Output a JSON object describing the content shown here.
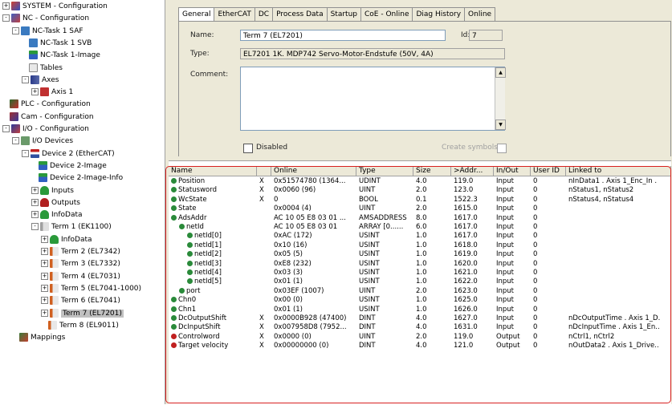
{
  "tree": [
    {
      "label": "SYSTEM - Configuration",
      "icon": "sys",
      "exp": "+"
    },
    {
      "label": "NC - Configuration",
      "icon": "nc",
      "exp": "-"
    },
    {
      "label": "NC-Task 1 SAF",
      "icon": "task",
      "exp": "-"
    },
    {
      "label": "NC-Task 1 SVB",
      "icon": "task",
      "exp": ""
    },
    {
      "label": "NC-Task 1-Image",
      "icon": "img",
      "exp": ""
    },
    {
      "label": "Tables",
      "icon": "tbl",
      "exp": ""
    },
    {
      "label": "Axes",
      "icon": "axes",
      "exp": "-"
    },
    {
      "label": "Axis 1",
      "icon": "axis",
      "exp": "+"
    },
    {
      "label": "PLC - Configuration",
      "icon": "plc",
      "exp": ""
    },
    {
      "label": "Cam - Configuration",
      "icon": "cam",
      "exp": ""
    },
    {
      "label": "I/O - Configuration",
      "icon": "io",
      "exp": "-"
    },
    {
      "label": "I/O Devices",
      "icon": "dev",
      "exp": "-"
    },
    {
      "label": "Device 2 (EtherCAT)",
      "icon": "eth",
      "exp": "-"
    },
    {
      "label": "Device 2-Image",
      "icon": "img",
      "exp": ""
    },
    {
      "label": "Device 2-Image-Info",
      "icon": "img",
      "exp": ""
    },
    {
      "label": "Inputs",
      "icon": "grn",
      "exp": "+"
    },
    {
      "label": "Outputs",
      "icon": "red",
      "exp": "+"
    },
    {
      "label": "InfoData",
      "icon": "grn",
      "exp": "+"
    },
    {
      "label": "Term 1 (EK1100)",
      "icon": "term",
      "exp": "-"
    },
    {
      "label": "InfoData",
      "icon": "grn",
      "exp": "+"
    },
    {
      "label": "Term 2 (EL7342)",
      "icon": "termo",
      "exp": "+"
    },
    {
      "label": "Term 3 (EL7332)",
      "icon": "termo",
      "exp": "+"
    },
    {
      "label": "Term 4 (EL7031)",
      "icon": "termo",
      "exp": "+"
    },
    {
      "label": "Term 5 (EL7041-1000)",
      "icon": "termo",
      "exp": "+"
    },
    {
      "label": "Term 6 (EL7041)",
      "icon": "termo",
      "exp": "+"
    },
    {
      "label": "Term 7 (EL7201)",
      "icon": "termo",
      "exp": "+",
      "selected": true
    },
    {
      "label": "Term 8 (EL9011)",
      "icon": "termo",
      "exp": ""
    },
    {
      "label": "Mappings",
      "icon": "map",
      "exp": ""
    }
  ],
  "tabs": [
    "General",
    "EtherCAT",
    "DC",
    "Process Data",
    "Startup",
    "CoE - Online",
    "Diag History",
    "Online"
  ],
  "general": {
    "name_label": "Name:",
    "name_value": "Term 7 (EL7201)",
    "id_label": "Id:",
    "id_value": "7",
    "type_label": "Type:",
    "type_value": "EL7201 1K. MDP742 Servo-Motor-Endstufe (50V, 4A)",
    "comment_label": "Comment:",
    "comment_value": "",
    "disabled_label": "Disabled",
    "create_symbols_label": "Create symbols"
  },
  "grid": {
    "headers": [
      "Name",
      "",
      "Online",
      "Type",
      "Size",
      ">Addr...",
      "In/Out",
      "User ID",
      "Linked to"
    ],
    "rows": [
      {
        "dir": "in",
        "indent": 0,
        "name": "Position",
        "x": "X",
        "online": "0x51574780 (1364...",
        "type": "UDINT",
        "size": "4.0",
        "addr": "119.0",
        "io": "Input",
        "uid": "0",
        "link": "nInData1 . Axis 1_Enc_In ."
      },
      {
        "dir": "in",
        "indent": 0,
        "name": "Statusword",
        "x": "X",
        "online": "0x0060 (96)",
        "type": "UINT",
        "size": "2.0",
        "addr": "123.0",
        "io": "Input",
        "uid": "0",
        "link": "nStatus1, nStatus2"
      },
      {
        "dir": "in",
        "indent": 0,
        "name": "WcState",
        "x": "X",
        "online": "0",
        "type": "BOOL",
        "size": "0.1",
        "addr": "1522.3",
        "io": "Input",
        "uid": "0",
        "link": "nStatus4, nStatus4"
      },
      {
        "dir": "in",
        "indent": 0,
        "name": "State",
        "x": "",
        "online": "0x0004 (4)",
        "type": "UINT",
        "size": "2.0",
        "addr": "1615.0",
        "io": "Input",
        "uid": "0",
        "link": ""
      },
      {
        "dir": "in",
        "indent": 0,
        "name": "AdsAddr",
        "x": "",
        "online": "AC 10 05 E8 03 01 ...",
        "type": "AMSADDRESS",
        "size": "8.0",
        "addr": "1617.0",
        "io": "Input",
        "uid": "0",
        "link": ""
      },
      {
        "dir": "in",
        "indent": 1,
        "name": "netId",
        "x": "",
        "online": "AC 10 05 E8 03 01",
        "type": "ARRAY [0......",
        "size": "6.0",
        "addr": "1617.0",
        "io": "Input",
        "uid": "0",
        "link": ""
      },
      {
        "dir": "in",
        "indent": 2,
        "name": "netId[0]",
        "x": "",
        "online": "0xAC (172)",
        "type": "USINT",
        "size": "1.0",
        "addr": "1617.0",
        "io": "Input",
        "uid": "0",
        "link": ""
      },
      {
        "dir": "in",
        "indent": 2,
        "name": "netId[1]",
        "x": "",
        "online": "0x10 (16)",
        "type": "USINT",
        "size": "1.0",
        "addr": "1618.0",
        "io": "Input",
        "uid": "0",
        "link": ""
      },
      {
        "dir": "in",
        "indent": 2,
        "name": "netId[2]",
        "x": "",
        "online": "0x05 (5)",
        "type": "USINT",
        "size": "1.0",
        "addr": "1619.0",
        "io": "Input",
        "uid": "0",
        "link": ""
      },
      {
        "dir": "in",
        "indent": 2,
        "name": "netId[3]",
        "x": "",
        "online": "0xE8 (232)",
        "type": "USINT",
        "size": "1.0",
        "addr": "1620.0",
        "io": "Input",
        "uid": "0",
        "link": ""
      },
      {
        "dir": "in",
        "indent": 2,
        "name": "netId[4]",
        "x": "",
        "online": "0x03 (3)",
        "type": "USINT",
        "size": "1.0",
        "addr": "1621.0",
        "io": "Input",
        "uid": "0",
        "link": ""
      },
      {
        "dir": "in",
        "indent": 2,
        "name": "netId[5]",
        "x": "",
        "online": "0x01 (1)",
        "type": "USINT",
        "size": "1.0",
        "addr": "1622.0",
        "io": "Input",
        "uid": "0",
        "link": ""
      },
      {
        "dir": "in",
        "indent": 1,
        "name": "port",
        "x": "",
        "online": "0x03EF (1007)",
        "type": "UINT",
        "size": "2.0",
        "addr": "1623.0",
        "io": "Input",
        "uid": "0",
        "link": ""
      },
      {
        "dir": "in",
        "indent": 0,
        "name": "Chn0",
        "x": "",
        "online": "0x00 (0)",
        "type": "USINT",
        "size": "1.0",
        "addr": "1625.0",
        "io": "Input",
        "uid": "0",
        "link": ""
      },
      {
        "dir": "in",
        "indent": 0,
        "name": "Chn1",
        "x": "",
        "online": "0x01 (1)",
        "type": "USINT",
        "size": "1.0",
        "addr": "1626.0",
        "io": "Input",
        "uid": "0",
        "link": ""
      },
      {
        "dir": "in",
        "indent": 0,
        "name": "DcOutputShift",
        "x": "X",
        "online": "0x0000B928 (47400)",
        "type": "DINT",
        "size": "4.0",
        "addr": "1627.0",
        "io": "Input",
        "uid": "0",
        "link": "nDcOutputTime . Axis 1_D."
      },
      {
        "dir": "in",
        "indent": 0,
        "name": "DcInputShift",
        "x": "X",
        "online": "0x007958D8 (7952...",
        "type": "DINT",
        "size": "4.0",
        "addr": "1631.0",
        "io": "Input",
        "uid": "0",
        "link": "nDcInputTime . Axis 1_En.."
      },
      {
        "dir": "out",
        "indent": 0,
        "name": "Controlword",
        "x": "X",
        "online": "0x0000 (0)",
        "type": "UINT",
        "size": "2.0",
        "addr": "119.0",
        "io": "Output",
        "uid": "0",
        "link": "nCtrl1, nCtrl2"
      },
      {
        "dir": "out",
        "indent": 0,
        "name": "Target velocity",
        "x": "X",
        "online": "0x00000000 (0)",
        "type": "DINT",
        "size": "4.0",
        "addr": "121.0",
        "io": "Output",
        "uid": "0",
        "link": "nOutData2 . Axis 1_Drive.."
      }
    ]
  }
}
